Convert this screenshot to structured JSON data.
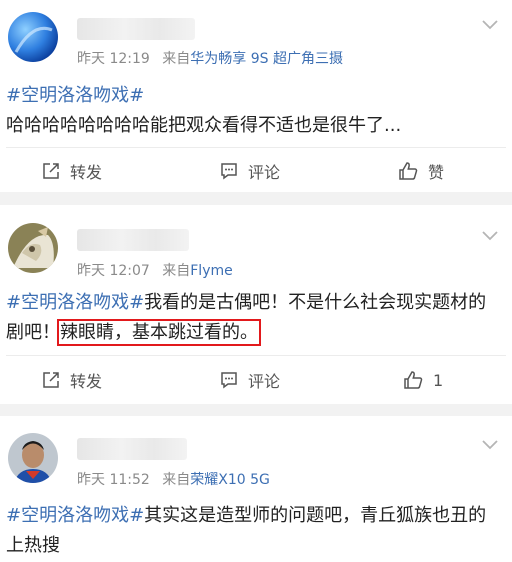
{
  "posts": [
    {
      "time": "昨天 12:19",
      "source_prefix": "来自",
      "source": "华为畅享 9S 超广角三摄",
      "text_tag": "#空明洛洛吻戏#",
      "text_body": "哈哈哈哈哈哈哈哈能把观众看得不适也是很牛了...",
      "actions": {
        "repost": "转发",
        "comment": "评论",
        "like": "赞"
      }
    },
    {
      "time": "昨天 12:07",
      "source_prefix": "来自",
      "source": "Flyme",
      "text_tag": "#空明洛洛吻戏#",
      "text_body": "我看的是古偶吧！不是什么社会现实题材的剧吧！",
      "text_highlight": "辣眼睛，基本跳过看的。",
      "actions": {
        "repost": "转发",
        "comment": "评论",
        "like": "1"
      }
    },
    {
      "time": "昨天 11:52",
      "source_prefix": "来自",
      "source": "荣耀X10 5G",
      "text_tag": "#空明洛洛吻戏#",
      "text_body": "其实这是造型师的问题吧，青丘狐族也丑的上热搜"
    }
  ],
  "colors": {
    "link": "#3d6fb3",
    "highlight_box": "#e2191c",
    "meta": "#8a8a8a"
  },
  "icons": [
    "chevron-down-icon",
    "repost-icon",
    "comment-icon",
    "like-icon"
  ]
}
